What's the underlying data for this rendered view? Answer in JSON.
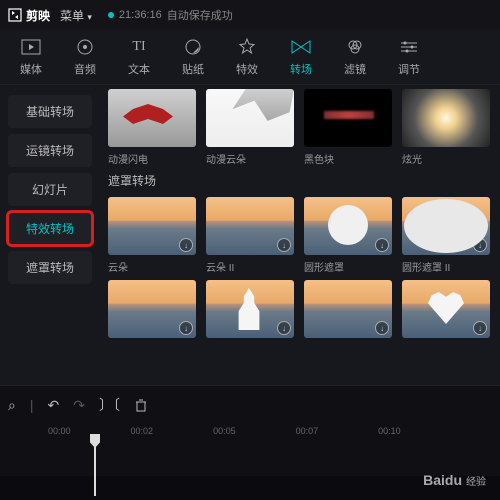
{
  "title": {
    "app": "剪映",
    "menu": "菜单",
    "autosave_time": "21:36:16",
    "autosave_text": "自动保存成功"
  },
  "tabs": [
    {
      "label": "媒体"
    },
    {
      "label": "音频"
    },
    {
      "label": "文本"
    },
    {
      "label": "贴纸"
    },
    {
      "label": "特效"
    },
    {
      "label": "转场",
      "active": true
    },
    {
      "label": "滤镜"
    },
    {
      "label": "调节"
    }
  ],
  "sidebar": {
    "items": [
      {
        "label": "基础转场"
      },
      {
        "label": "运镜转场"
      },
      {
        "label": "幻灯片"
      },
      {
        "label": "特效转场",
        "selected": true
      },
      {
        "label": "遮罩转场"
      }
    ]
  },
  "gallery": {
    "row1": [
      {
        "label": "动漫闪电"
      },
      {
        "label": "动漫云朵"
      },
      {
        "label": "黑色块"
      },
      {
        "label": "炫光"
      }
    ],
    "section": "遮罩转场",
    "row2": [
      {
        "label": "云朵"
      },
      {
        "label": "云朵 II"
      },
      {
        "label": "圆形遮罩"
      },
      {
        "label": "圆形遮罩 II"
      }
    ],
    "row3": [
      {
        "label": ""
      },
      {
        "label": ""
      },
      {
        "label": ""
      },
      {
        "label": ""
      }
    ]
  },
  "timeline": {
    "marks": [
      "00:00",
      "00:02",
      "00:05",
      "00:07",
      "00:10"
    ]
  },
  "watermark": {
    "brand": "Baidu",
    "sub": "经验"
  }
}
